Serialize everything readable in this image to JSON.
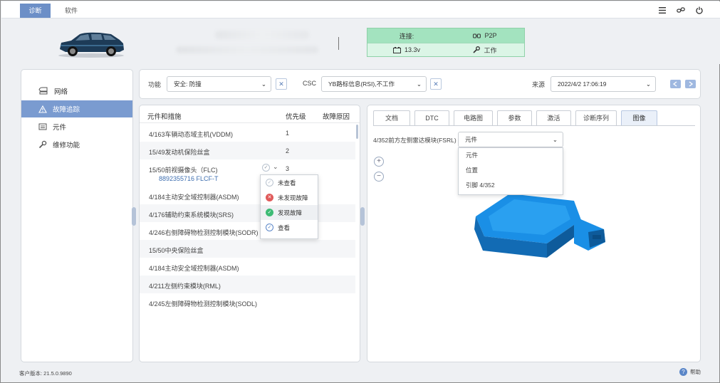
{
  "topbar": {
    "tabs": [
      "诊断",
      "软件"
    ],
    "icons": [
      "menu-icon",
      "link-icon",
      "power-icon"
    ]
  },
  "connection": {
    "label": "连接:",
    "mode": "P2P",
    "voltage": "13.3v",
    "state": "工作"
  },
  "nav": {
    "items": [
      {
        "label": "网络",
        "icon": "network-icon"
      },
      {
        "label": "故障追踪",
        "icon": "warning-icon"
      },
      {
        "label": "元件",
        "icon": "component-icon"
      },
      {
        "label": "维修功能",
        "icon": "wrench-icon"
      }
    ],
    "active_index": 1
  },
  "filters": {
    "function_label": "功能",
    "function_value": "安全: 防撞",
    "csc_label": "CSC",
    "csc_value": "YB路标信息(RSI),不工作",
    "source_label": "来源",
    "source_value": "2022/4/2  17:06:19"
  },
  "list": {
    "columns": [
      "元件和措施",
      "优先级",
      "故障原因"
    ],
    "rows": [
      {
        "name": "4/163车辆动态域主机(VDDM)",
        "priority": "1"
      },
      {
        "name": "15/49发动机保险丝盒",
        "priority": "2"
      },
      {
        "name": "15/50前视摄像头（FLC)",
        "priority": "3",
        "sub": "8892355716 FLCF-T"
      },
      {
        "name": "4/184主动安全域控制器(ASDM)",
        "priority": ""
      },
      {
        "name": "4/176辅助约束系统模块(SRS)",
        "priority": ""
      },
      {
        "name": "4/246右侧障碍物检测控制模块(SODR)",
        "priority": ""
      },
      {
        "name": "15/50中央保险丝盒",
        "priority": ""
      },
      {
        "name": "4/184主动安全域控制器(ASDM)",
        "priority": ""
      },
      {
        "name": "4/211左侧约束模块(RML)",
        "priority": ""
      },
      {
        "name": "4/245左侧障碍物检测控制模块(SODL)",
        "priority": ""
      }
    ]
  },
  "status_popup": {
    "items": [
      "未查看",
      "未发现故障",
      "发现故障",
      "查看"
    ],
    "colors": [
      "#b9c3cf",
      "#e05a5a",
      "#3dbb75",
      "#5a86c8"
    ]
  },
  "detail": {
    "tabs": [
      "文档",
      "DTC",
      "电路图",
      "参数",
      "激活",
      "诊断序列",
      "图像"
    ],
    "active_tab": 6,
    "component_label": "4/352前方左侧雷达模块(FSRL)",
    "select_value": "元件",
    "dropdown_options": [
      "元件",
      "位置",
      "引脚 4/352"
    ]
  },
  "footer": {
    "version": "客户版本: 21.5.0.9890",
    "help": "帮助"
  },
  "colors": {
    "accent": "#6c8fc7",
    "active_nav": "#7a9bd0",
    "connection_bg": "#a3e3bf",
    "part_blue": "#1a8fe6"
  }
}
